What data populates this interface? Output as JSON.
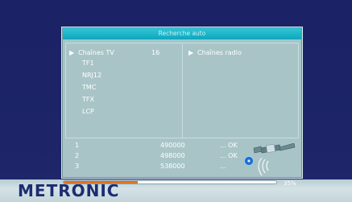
{
  "dialog": {
    "title": "Recherche auto",
    "tv": {
      "header": "Chaînes TV",
      "count": "16",
      "channels": [
        "TF1",
        "NRJ12",
        "TMC",
        "TFX",
        "LCP"
      ]
    },
    "radio": {
      "header": "Chaînes radio"
    },
    "frequencies": [
      {
        "index": "1",
        "freq": "490000",
        "status": "... OK"
      },
      {
        "index": "2",
        "freq": "498000",
        "status": "... OK"
      },
      {
        "index": "3",
        "freq": "538000",
        "status": "..."
      }
    ]
  },
  "icons": {
    "header_arrow": "triangle-right-icon",
    "satellite": "satellite-icon",
    "disc": "disc-icon"
  },
  "brand": {
    "name": "METRONIC"
  },
  "progress": {
    "value": 0.35,
    "label": "35%"
  },
  "colors": {
    "title_bar": "#0fa6bc",
    "dialog_bg": "#a9c4c7",
    "screen_bg": "#1b2266",
    "progress_fill": "#e2721f"
  }
}
